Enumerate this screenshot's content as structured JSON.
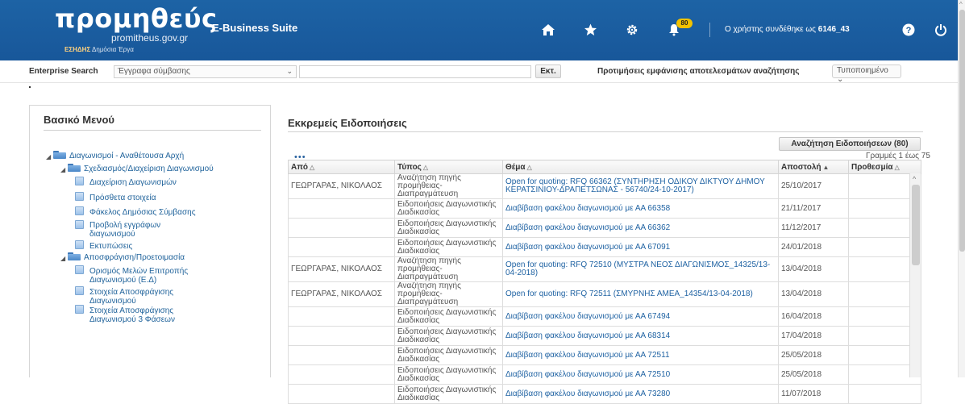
{
  "header": {
    "logo_main": "προμηθεύς",
    "logo_sub": "promitheus.gov.gr",
    "logo_esidis": "ΕΣΗΔΗΣ",
    "logo_tagline": "Δημόσια Έργα",
    "suite": "E-Business Suite",
    "notifications_count": "80",
    "user_label": "Ο χρήστης συνδέθηκε ως",
    "user_name": "6146_43",
    "icons": [
      "home-icon",
      "favorites-star-icon",
      "settings-gear-icon",
      "notifications-bell-icon",
      "help-icon",
      "logout-power-icon"
    ]
  },
  "search": {
    "label": "Enterprise Search",
    "category": "Έγγραφα σύμβασης",
    "query": "",
    "button": "Εκτ.",
    "pref_label": "Προτιμήσεις εμφάνισης αποτελεσμάτων αναζήτησης",
    "pref_value": "Τυποποιημένο"
  },
  "menu": {
    "title": "Βασικό Μενού",
    "items": [
      {
        "label": "Διαγωνισμοί - Αναθέτουσα Αρχή"
      },
      {
        "label": "Σχεδιασμός/Διαχείριση Διαγωνισμού"
      },
      {
        "label": "Διαχείριση Διαγωνισμών"
      },
      {
        "label": "Πρόσθετα στοιχεία"
      },
      {
        "label": "Φάκελος Δημόσιας Σύμβασης"
      },
      {
        "label": "Προβολή εγγράφων διαγωνισμού"
      },
      {
        "label": "Εκτυπώσεις"
      },
      {
        "label": "Αποσφράγιση/Προετοιμασία"
      },
      {
        "label": "Ορισμός Μελών Επιτροπής Διαγωνισμού (Ε.Δ)"
      },
      {
        "label": "Στοιχεία Αποσφράγισης Διαγωνισμού"
      },
      {
        "label": "Στοιχεία Αποσφράγισης Διαγωνισμού 3 Φάσεων"
      }
    ]
  },
  "notifications": {
    "title": "Εκκρεμείς Ειδοποιήσεις",
    "search_button": "Αναζήτηση Ειδοποιήσεων (80)",
    "more": "•••",
    "rows_range": "Γραμμές 1 έως 75",
    "columns": [
      "Από",
      "Τύπος",
      "Θέμα",
      "Αποστολή",
      "Προθεσμία"
    ],
    "rows": [
      {
        "from": "ΓΕΩΡΓΑΡΑΣ, ΝΙΚΟΛΑΟΣ",
        "type": "Αναζήτηση πηγής προμήθειας-Διαπραγμάτευση",
        "subject": "Open for quoting: RFQ 66362 (ΣΥΝΤΗΡΗΣΗ ΟΔΙΚΟΥ ΔΙΚΤΥΟΥ ΔΗΜΟΥ ΚΕΡΑΤΣΙΝΙΟΥ-ΔΡΑΠΕΤΣΩΝΑΣ - 56740/24-10-2017)",
        "sent": "25/10/2017",
        "due": ""
      },
      {
        "from": "",
        "type": "Ειδοποιήσεις Διαγωνιστικής Διαδικασίας",
        "subject": "Διαβίβαση φακέλου διαγωνισμού με ΑΑ 66358",
        "sent": "21/11/2017",
        "due": ""
      },
      {
        "from": "",
        "type": "Ειδοποιήσεις Διαγωνιστικής Διαδικασίας",
        "subject": "Διαβίβαση φακέλου διαγωνισμού με ΑΑ 66362",
        "sent": "11/12/2017",
        "due": ""
      },
      {
        "from": "",
        "type": "Ειδοποιήσεις Διαγωνιστικής Διαδικασίας",
        "subject": "Διαβίβαση φακέλου διαγωνισμού με ΑΑ 67091",
        "sent": "24/01/2018",
        "due": ""
      },
      {
        "from": "ΓΕΩΡΓΑΡΑΣ, ΝΙΚΟΛΑΟΣ",
        "type": "Αναζήτηση πηγής προμήθειας-Διαπραγμάτευση",
        "subject": "Open for quoting: RFQ 72510 (ΜΥΣΤΡΑ ΝΕΟΣ ΔΙΑΓΩΝΙΣΜΟΣ_14325/13-04-2018)",
        "sent": "13/04/2018",
        "due": ""
      },
      {
        "from": "ΓΕΩΡΓΑΡΑΣ, ΝΙΚΟΛΑΟΣ",
        "type": "Αναζήτηση πηγής προμήθειας-Διαπραγμάτευση",
        "subject": "Open for quoting: RFQ 72511 (ΣΜΥΡΝΗΣ ΑΜΕΑ_14354/13-04-2018)",
        "sent": "13/04/2018",
        "due": ""
      },
      {
        "from": "",
        "type": "Ειδοποιήσεις Διαγωνιστικής Διαδικασίας",
        "subject": "Διαβίβαση φακέλου διαγωνισμού με ΑΑ 67494",
        "sent": "16/04/2018",
        "due": ""
      },
      {
        "from": "",
        "type": "Ειδοποιήσεις Διαγωνιστικής Διαδικασίας",
        "subject": "Διαβίβαση φακέλου διαγωνισμού με ΑΑ 68314",
        "sent": "17/04/2018",
        "due": ""
      },
      {
        "from": "",
        "type": "Ειδοποιήσεις Διαγωνιστικής Διαδικασίας",
        "subject": "Διαβίβαση φακέλου διαγωνισμού με ΑΑ 72511",
        "sent": "25/05/2018",
        "due": ""
      },
      {
        "from": "",
        "type": "Ειδοποιήσεις Διαγωνιστικής Διαδικασίας",
        "subject": "Διαβίβαση φακέλου διαγωνισμού με ΑΑ 72510",
        "sent": "25/05/2018",
        "due": ""
      },
      {
        "from": "",
        "type": "Ειδοποιήσεις Διαγωνιστικής Διαδικασίας",
        "subject": "Διαβίβαση φακέλου διαγωνισμού με ΑΑ 73280",
        "sent": "11/07/2018",
        "due": ""
      }
    ]
  },
  "colors": {
    "header_bg": "#1c5e9e",
    "link": "#2063a3",
    "badge": "#f2c200"
  }
}
